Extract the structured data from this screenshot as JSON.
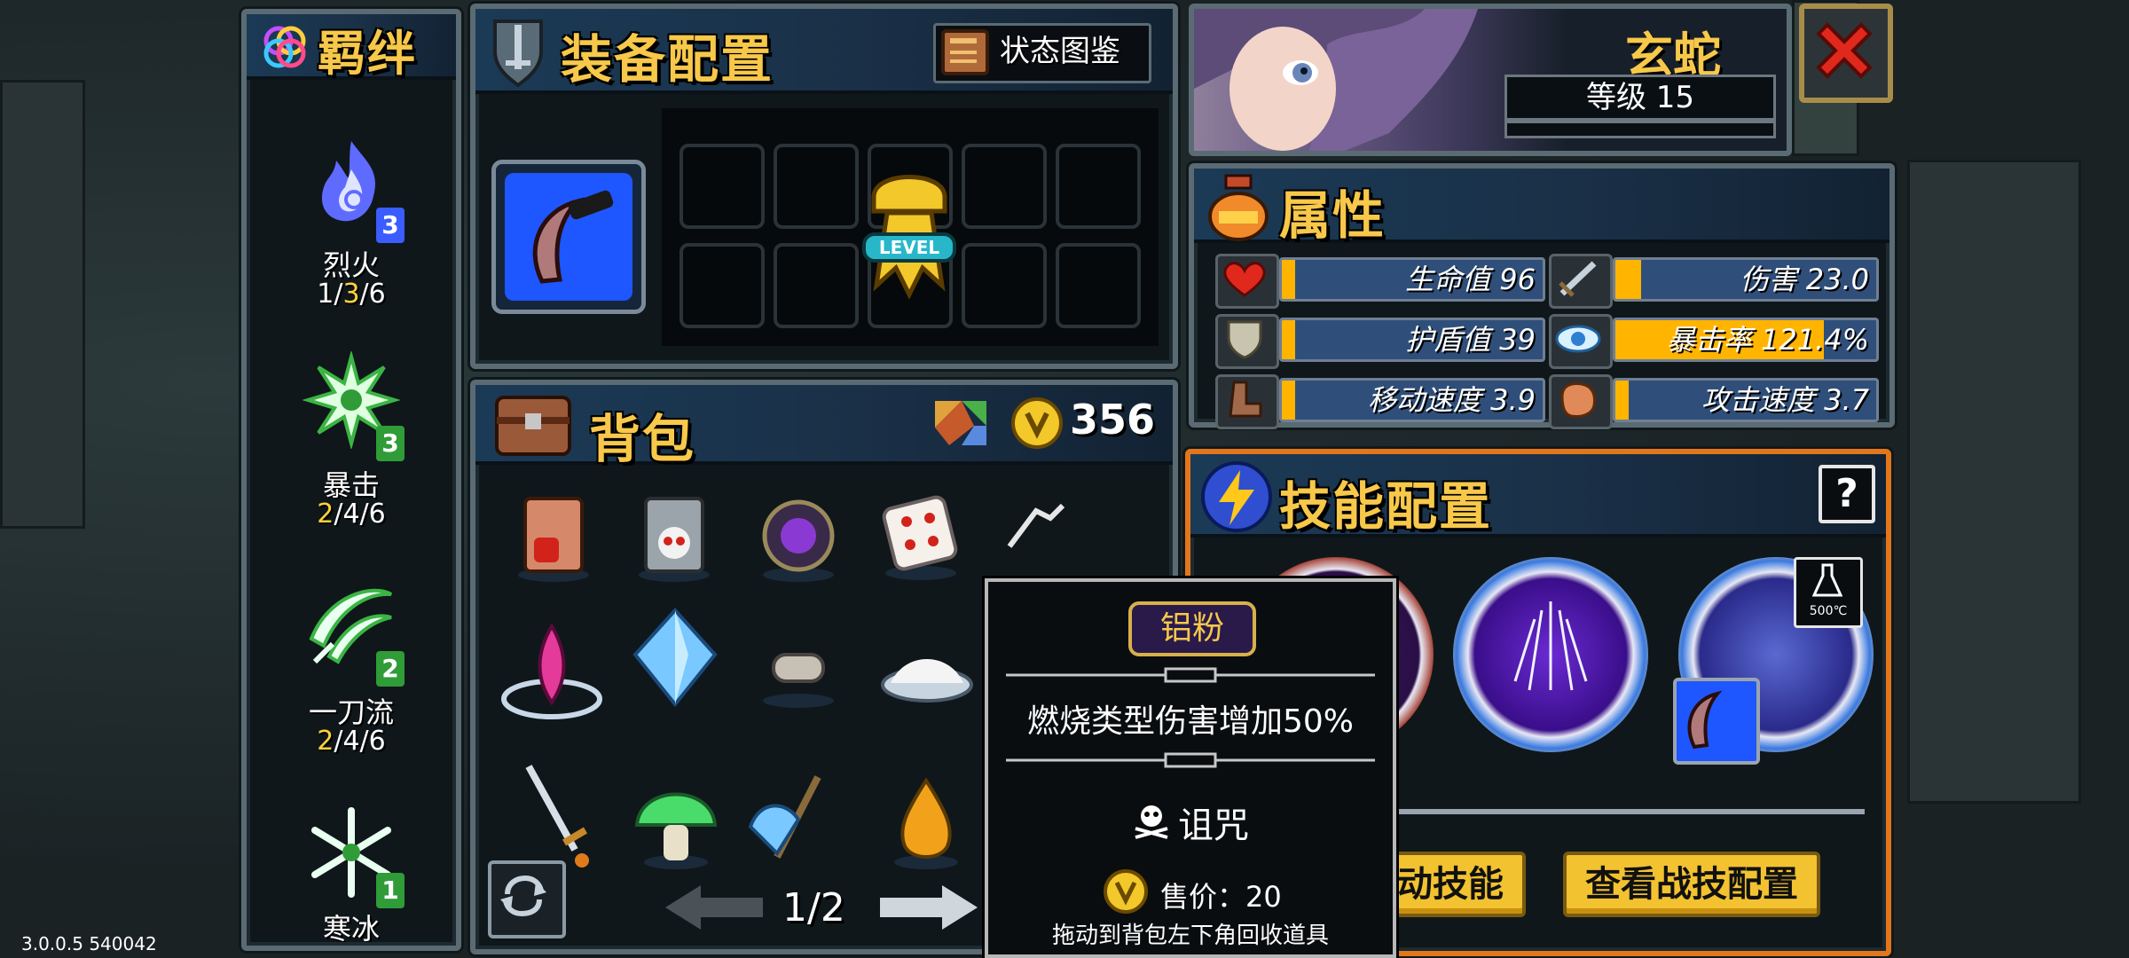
{
  "version": "3.0.0.5 540042",
  "bonds": {
    "title": "羁绊",
    "items": [
      {
        "name": "烈火",
        "count": "3",
        "prog": [
          "1",
          "/",
          "3",
          "/6"
        ],
        "color": "#3b5cff"
      },
      {
        "name": "暴击",
        "count": "3",
        "prog": [
          "2",
          "/4/6",
          "",
          ""
        ],
        "color": "#2f9c38"
      },
      {
        "name": "一刀流",
        "count": "2",
        "prog": [
          "2",
          "/4/6",
          "",
          ""
        ],
        "color": "#2f9c38"
      },
      {
        "name": "寒冰",
        "count": "1",
        "prog": [
          "",
          "",
          "",
          ""
        ],
        "color": "#2f9c38"
      }
    ]
  },
  "equipment": {
    "title": "装备配置",
    "codex_label": "状态图鉴",
    "level_label": "LEVEL"
  },
  "character": {
    "name": "玄蛇",
    "level": "等级 15"
  },
  "attributes": {
    "title": "属性",
    "items": [
      {
        "label": "生命值 96",
        "icon": "heart-icon",
        "fill": 0.05
      },
      {
        "label": "伤害 23.0",
        "icon": "sword-icon",
        "fill": 0.1
      },
      {
        "label": "护盾值 39",
        "icon": "shield-icon",
        "fill": 0.05
      },
      {
        "label": "暴击率 121.4%",
        "icon": "eye-icon",
        "fill": 0.8
      },
      {
        "label": "移动速度 3.9",
        "icon": "boot-icon",
        "fill": 0.05
      },
      {
        "label": "攻击速度 3.7",
        "icon": "fist-icon",
        "fill": 0.05
      }
    ]
  },
  "backpack": {
    "title": "背包",
    "coins": "356",
    "page": "1/2"
  },
  "skills": {
    "title": "技能配置",
    "help": "?",
    "temp_badge": "500℃",
    "btn_passive": "查看被动技能",
    "btn_combat": "查看战技配置"
  },
  "tooltip": {
    "name": "铝粉",
    "desc": "燃烧类型伤害增加50%",
    "tag": "诅咒",
    "price": "售价：20",
    "hint": "拖动到背包左下角回收道具"
  },
  "colors": {
    "accent_gold": "#f7c84a",
    "bar_blue": "#2f4f7a",
    "bar_fill": "#ffb400",
    "close_red": "#d8261b"
  }
}
